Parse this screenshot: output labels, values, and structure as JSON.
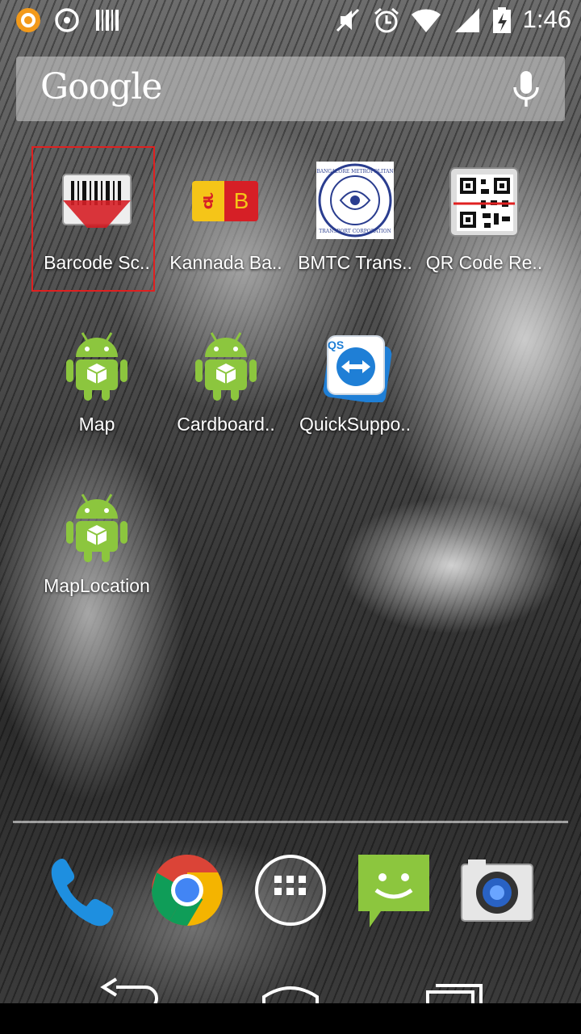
{
  "status_bar": {
    "time": "1:46",
    "left_icons": [
      "app-notification-icon",
      "sync-icon",
      "barcode-notification-icon"
    ],
    "right_icons": [
      "mute-icon",
      "alarm-icon",
      "wifi-icon",
      "signal-icon",
      "battery-charging-icon"
    ]
  },
  "search": {
    "logo_text": "Google",
    "mic_icon": "mic-icon"
  },
  "apps": [
    {
      "label": "Barcode Sc..",
      "icon": "barcode-scanner-icon",
      "selected": true
    },
    {
      "label": "Kannada Ba..",
      "icon": "kannada-icon",
      "glyph_left": "ಕ",
      "glyph_right": "B"
    },
    {
      "label": "BMTC Trans..",
      "icon": "bmtc-icon",
      "emblem_text_top": "BANGALORE METROPOLITAN",
      "emblem_text_bottom": "TRANSPORT CORPORATION"
    },
    {
      "label": "QR Code Re..",
      "icon": "qr-code-icon"
    },
    {
      "label": "Map",
      "icon": "android-icon"
    },
    {
      "label": "Cardboard..",
      "icon": "android-icon"
    },
    {
      "label": "QuickSuppo..",
      "icon": "teamviewer-icon",
      "badge": "QS"
    },
    {
      "label": "MapLocation",
      "icon": "android-icon"
    }
  ],
  "dock": [
    {
      "name": "phone-icon"
    },
    {
      "name": "chrome-icon"
    },
    {
      "name": "app-drawer-icon"
    },
    {
      "name": "messaging-icon"
    },
    {
      "name": "camera-icon"
    }
  ],
  "nav": [
    "back-icon",
    "home-icon",
    "recents-icon"
  ],
  "colors": {
    "accent_red": "#e02020",
    "android_green": "#8cc63e",
    "chrome_blue": "#4285f4"
  }
}
